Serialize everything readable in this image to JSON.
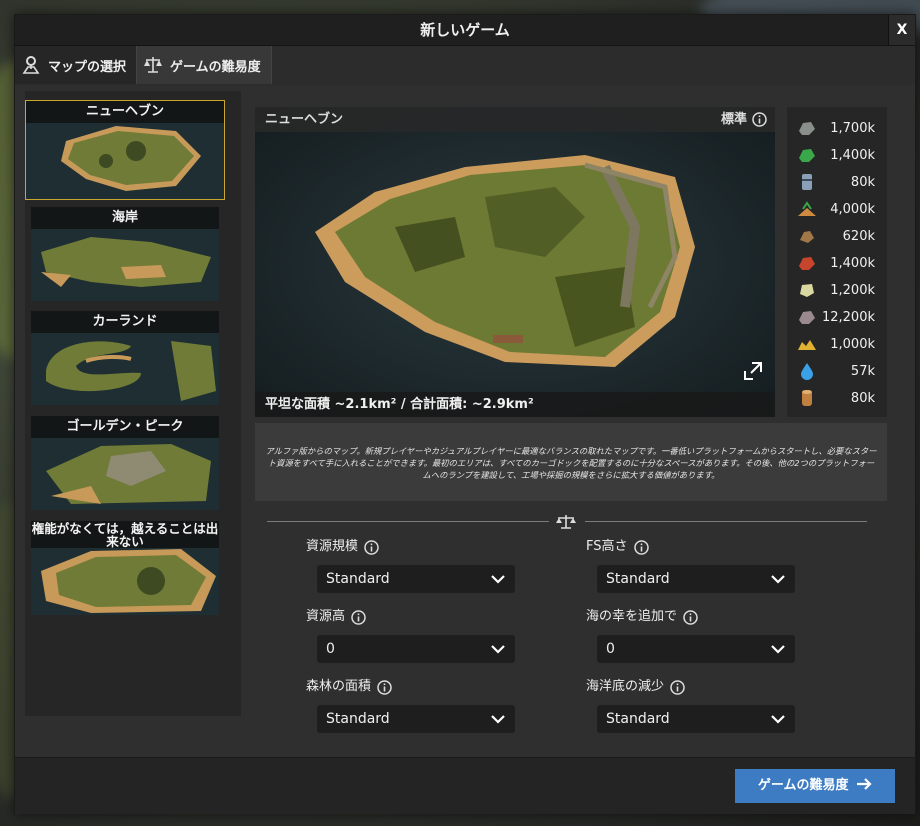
{
  "window": {
    "title": "新しいゲーム",
    "close_label": "X"
  },
  "tabs": [
    {
      "label": "マップの選択",
      "icon": "map-marker-icon"
    },
    {
      "label": "ゲームの難易度",
      "icon": "scales-icon"
    }
  ],
  "maps": [
    {
      "name": "ニューヘブン",
      "selected": true
    },
    {
      "name": "海岸"
    },
    {
      "name": "カーランド"
    },
    {
      "name": "ゴールデン・ピーク"
    },
    {
      "name": "権能がなくては，越えることは出来ない"
    }
  ],
  "preview": {
    "map_name": "ニューヘブン",
    "difficulty": "標準",
    "area_text": "平坦な面積 ~2.1km² / 合計面積: ~2.9km²"
  },
  "resources": [
    {
      "icon": "iron-ore-icon",
      "value": "1,700k",
      "color": "#8a8f8c"
    },
    {
      "icon": "copper-ore-icon",
      "value": "1,400k",
      "color": "#3aa84a"
    },
    {
      "icon": "oil-barrel-icon",
      "value": "80k",
      "color": "#8aa0b8"
    },
    {
      "icon": "sand-icon",
      "value": "4,000k",
      "color": "#d08a40"
    },
    {
      "icon": "coal-icon",
      "value": "620k",
      "color": "#a07848"
    },
    {
      "icon": "bauxite-icon",
      "value": "1,400k",
      "color": "#c8452d"
    },
    {
      "icon": "limestone-icon",
      "value": "1,200k",
      "color": "#d8d8a0"
    },
    {
      "icon": "rock-icon",
      "value": "12,200k",
      "color": "#9a8a90"
    },
    {
      "icon": "gold-ore-icon",
      "value": "1,000k",
      "color": "#e0b030"
    },
    {
      "icon": "water-icon",
      "value": "57k",
      "color": "#3aa0e8"
    },
    {
      "icon": "wood-log-icon",
      "value": "80k",
      "color": "#c08040"
    }
  ],
  "description": "アルファ版からのマップ。新規プレイヤーやカジュアルプレイヤーに最適なバランスの取れたマップです。一番低いプラットフォームからスタートし、必要なスタート資源をすべて手に入れることができます。最初のエリアは、すべてのカーゴドックを配置するのに十分なスペースがあります。その後、他の2つのプラットフォームへのランプを建設して、工場や採掘の規模をさらに拡大する価値があります。",
  "settings": [
    {
      "label": "資源規模",
      "value": "Standard"
    },
    {
      "label": "FS高さ",
      "value": "Standard"
    },
    {
      "label": "資源高",
      "value": "0"
    },
    {
      "label": "海の幸を追加で",
      "value": "0"
    },
    {
      "label": "森林の面積",
      "value": "Standard"
    },
    {
      "label": "海洋底の減少",
      "value": "Standard"
    }
  ],
  "footer": {
    "next_label": "ゲームの難易度"
  }
}
